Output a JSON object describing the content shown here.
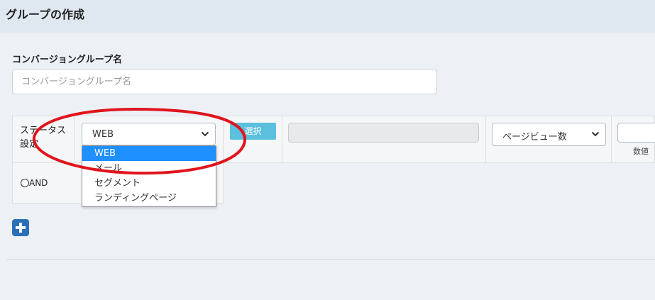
{
  "header": {
    "title": "グループの作成"
  },
  "group_name": {
    "label": "コンバージョングループ名",
    "placeholder": "コンバージョングループ名",
    "value": ""
  },
  "condition": {
    "status_label_line1": "ステータス",
    "status_label_line2": "設定",
    "type_select": {
      "value": "WEB"
    },
    "select_button": "選択",
    "metric_select": {
      "value": "ページビュー数"
    },
    "number_label": "数値",
    "and_label": "AND"
  },
  "dropdown": {
    "options": [
      "WEB",
      "メール",
      "セグメント",
      "ランディングページ"
    ],
    "selected_index": 0
  },
  "icons": {
    "add": "plus-icon",
    "select_chevron": "chevron-down-icon"
  },
  "colors": {
    "header_bg": "#dfe7f1",
    "page_bg": "#edf1f5",
    "select_button_bg": "#5bc0de",
    "selected_option_bg": "#1e90ff",
    "add_button_bg": "#2a6fb8",
    "annotation": "#e0141c"
  }
}
